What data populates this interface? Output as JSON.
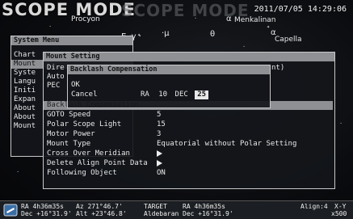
{
  "header": {
    "mode_title": "SCOPE MODE",
    "mode_ghost": "SCOPE MODE",
    "datetime": "2011/07/05 14:29:06"
  },
  "sky": {
    "labels": [
      "Procyon",
      "Menkalinan",
      "Capella"
    ],
    "marks": [
      "E ·γ ·",
      "·μ",
      "α",
      "θ",
      "α"
    ]
  },
  "system_menu": {
    "title": "System Menu",
    "items": [
      "Chart",
      "Mount",
      "Syste",
      "Langu",
      "Initi",
      "Expan",
      "About",
      "About",
      "Mount"
    ],
    "selected_index": 1
  },
  "mount_setting": {
    "title": "Mount Setting",
    "rows": [
      {
        "label": "Dire",
        "value": ""
      },
      {
        "label": "Auto",
        "value": ""
      },
      {
        "label": "PEC",
        "value": ""
      },
      {
        "label": "Backlash Compensation",
        "value": ""
      },
      {
        "label": "GOTO Speed",
        "value": "5"
      },
      {
        "label": "Polar Scope Light",
        "value": "15"
      },
      {
        "label": "Motor Power",
        "value": "3"
      },
      {
        "label": "Mount Type",
        "value": "Equatorial without Polar Setting"
      },
      {
        "label": "Cross Over Meridian",
        "value": ""
      },
      {
        "label": "Delete Align Point Data",
        "value": ""
      },
      {
        "label": "Following Object",
        "value": "ON"
      }
    ],
    "selected_index": 3,
    "right_fragment": "nt)"
  },
  "backlash": {
    "title": "Backlash Compensation",
    "ok_label": "OK",
    "cancel_label": "Cancel",
    "ra_label": "RA",
    "ra_value": "10",
    "dec_label": "DEC",
    "dec_value": "25"
  },
  "status": {
    "ra_label": "RA",
    "ra_value": "4h36m35s",
    "dec_label": "Dec",
    "dec_value": "+16°31.9'",
    "az_label": "Az",
    "az_value": "271°46.7'",
    "alt_label": "Alt",
    "alt_value": "+23°46.8'",
    "target_label": "TARGET",
    "target_name": "Aldebaran",
    "t_ra_label": "RA",
    "t_ra_value": "4h36m35s",
    "t_dec_label": "Dec",
    "t_dec_value": "+16°31.9'",
    "align_label": "Align:4",
    "xy_label": "X-Y",
    "zoom": "x500"
  }
}
